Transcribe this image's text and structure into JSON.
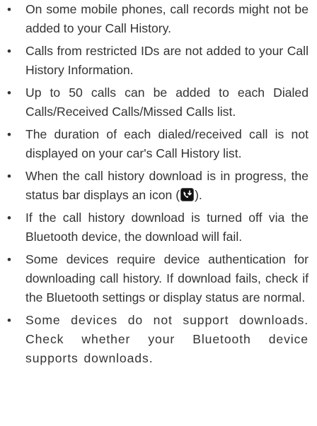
{
  "notes": [
    {
      "text": "On some mobile phones, call records might not be added to your Call History."
    },
    {
      "text": "Calls from restricted IDs are not added to your Call History Information."
    },
    {
      "text": "Up to 50 calls can be added to each Dialed Calls/Received Calls/Missed Calls list."
    },
    {
      "text": "The duration of each dialed/received call is not displayed on your car's Call History list."
    },
    {
      "text_before": "When the call history download is in progress, the status bar displays an icon (",
      "icon": "phone-download-icon",
      "text_after": ")."
    },
    {
      "text": "If the call history download is turned off via the Bluetooth device, the download will fail."
    },
    {
      "text": "Some devices require device authentication for downloading call history. If download fails, check if the Bluetooth settings or display status are normal."
    },
    {
      "text": "Some devices do not support downloads. Check whether your Bluetooth device supports downloads."
    }
  ],
  "bullet_glyph": "•",
  "colors": {
    "text": "#333333",
    "icon_bg": "#111111",
    "icon_fg": "#ffffff"
  }
}
